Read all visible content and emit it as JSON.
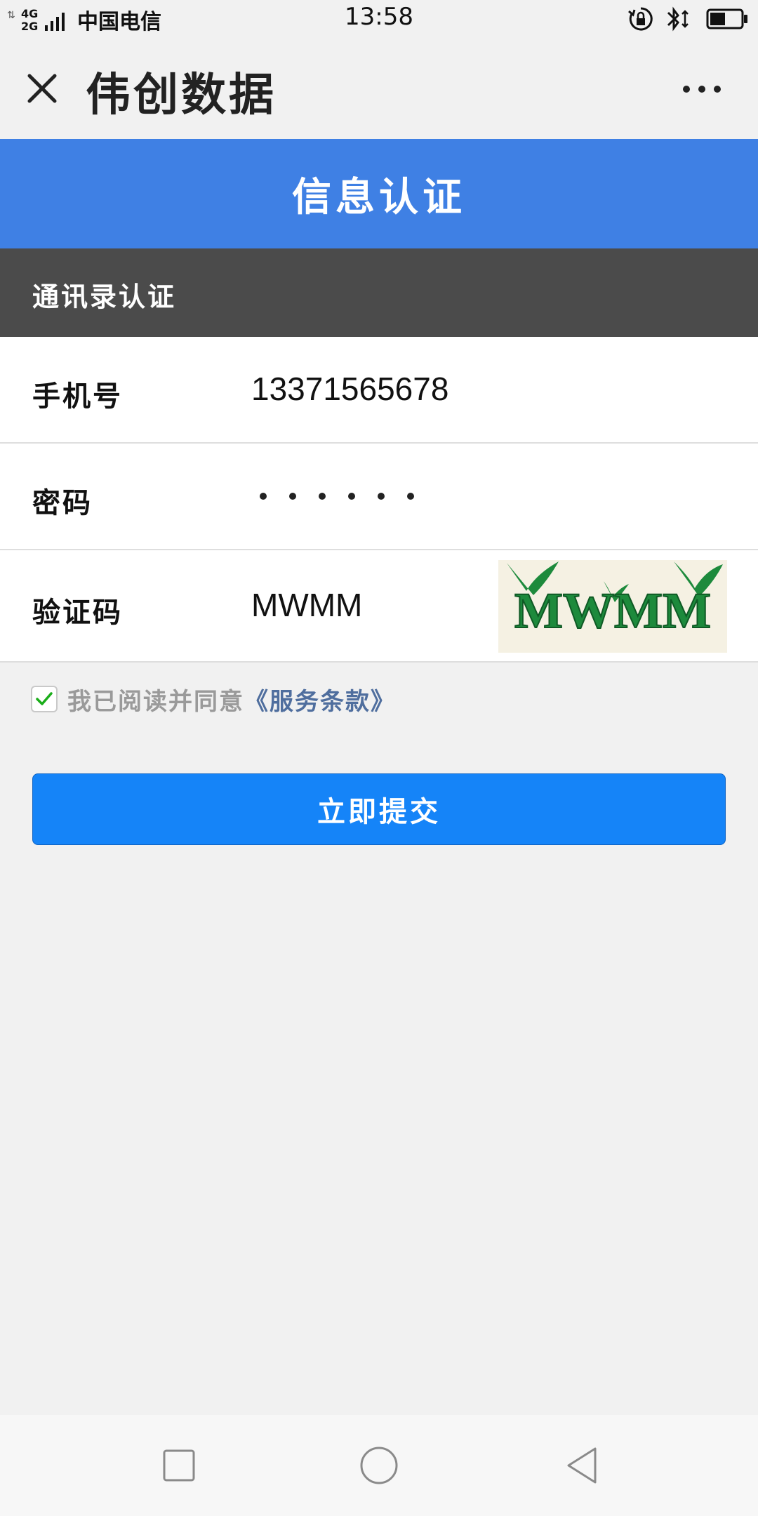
{
  "status_bar": {
    "network_top": "4G",
    "network_bottom": "2G",
    "carrier": "中国电信",
    "time": "13:58",
    "icons": [
      "rotation-lock-icon",
      "bluetooth-icon",
      "battery-icon"
    ],
    "battery_level": 0.5
  },
  "nav": {
    "close_icon": "close-icon",
    "title": "伟创数据",
    "more_icon": "more-icon"
  },
  "header": {
    "title": "信息认证"
  },
  "section": {
    "title": "通讯录认证"
  },
  "form": {
    "phone_label": "手机号",
    "phone_value": "13371565678",
    "password_label": "密码",
    "password_length": 6,
    "captcha_label": "验证码",
    "captcha_value": "MWMM",
    "captcha_image_text": "MWMM"
  },
  "agreement": {
    "checked": true,
    "text": "我已阅读并同意",
    "link": "《服务条款》"
  },
  "submit": {
    "label": "立即提交"
  },
  "colors": {
    "header_blue": "#3f80e4",
    "section_gray": "#4b4b4b",
    "button_blue": "#1584f8",
    "link_blue": "#4f6e9e",
    "check_green": "#1aad19",
    "captcha_green": "#1d8a3c"
  },
  "bottom_nav": {
    "icons": [
      "recent-apps-icon",
      "home-icon",
      "back-icon"
    ]
  }
}
